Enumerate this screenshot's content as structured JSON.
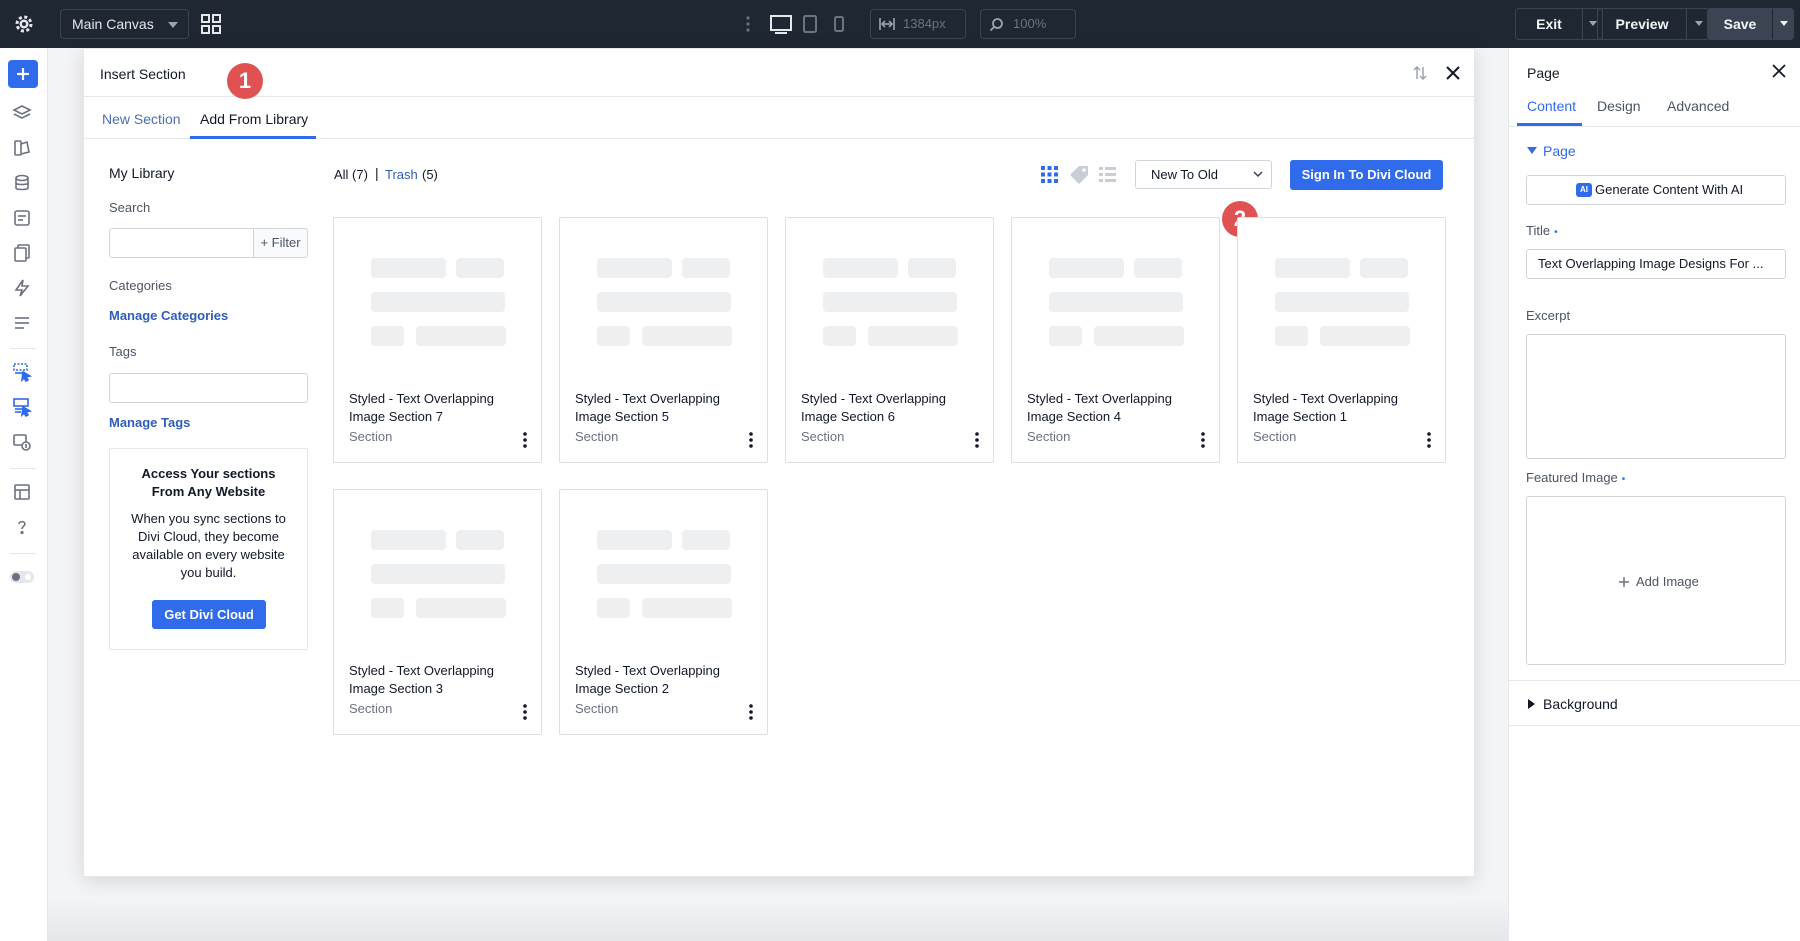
{
  "topbar": {
    "canvas_select": "Main Canvas",
    "width_value": "1384px",
    "zoom_value": "100%",
    "exit_label": "Exit",
    "preview_label": "Preview",
    "save_label": "Save"
  },
  "modal": {
    "title": "Insert Section",
    "tabs": [
      "New Section",
      "Add From Library"
    ],
    "active_tab": "Add From Library",
    "callouts": [
      "1",
      "2"
    ]
  },
  "library": {
    "heading": "My Library",
    "search_label": "Search",
    "filter_label": "+ Filter",
    "categories_label": "Categories",
    "manage_categories": "Manage Categories",
    "tags_label": "Tags",
    "manage_tags": "Manage Tags",
    "promo": {
      "heading": "Access Your sections\nFrom Any Website",
      "text": "When you sync sections to\nDivi Cloud, they become\navailable on every website\nyou build.",
      "button": "Get Divi Cloud"
    },
    "all_label": "All (7)",
    "separator": "|",
    "trash_label": "Trash",
    "trash_count": "(5)",
    "sort_value": "New To Old",
    "signin_button": "Sign In To Divi Cloud",
    "active_view": "grid",
    "items": [
      {
        "title": "Styled - Text Overlapping Image Section 7",
        "type": "Section"
      },
      {
        "title": "Styled - Text Overlapping Image Section 5",
        "type": "Section"
      },
      {
        "title": "Styled - Text Overlapping Image Section 6",
        "type": "Section"
      },
      {
        "title": "Styled - Text Overlapping Image Section 4",
        "type": "Section"
      },
      {
        "title": "Styled - Text Overlapping Image Section 1",
        "type": "Section"
      },
      {
        "title": "Styled - Text Overlapping Image Section 3",
        "type": "Section"
      },
      {
        "title": "Styled - Text Overlapping Image Section 2",
        "type": "Section"
      }
    ]
  },
  "right_panel": {
    "title": "Page",
    "tabs": [
      "Content",
      "Design",
      "Advanced"
    ],
    "active_tab": "Content",
    "section_page": "Page",
    "ai_button": "Generate Content With AI",
    "ai_icon_text": "AI",
    "title_label": "Title",
    "title_value": "Text Overlapping Image Designs For ...",
    "excerpt_label": "Excerpt",
    "featured_image_label": "Featured Image",
    "add_image": "Add Image",
    "background_label": "Background",
    "required_marker": "•"
  },
  "colors": {
    "accent": "#2f6bea",
    "topbar_bg": "#1f2733",
    "callout": "#e05252"
  }
}
